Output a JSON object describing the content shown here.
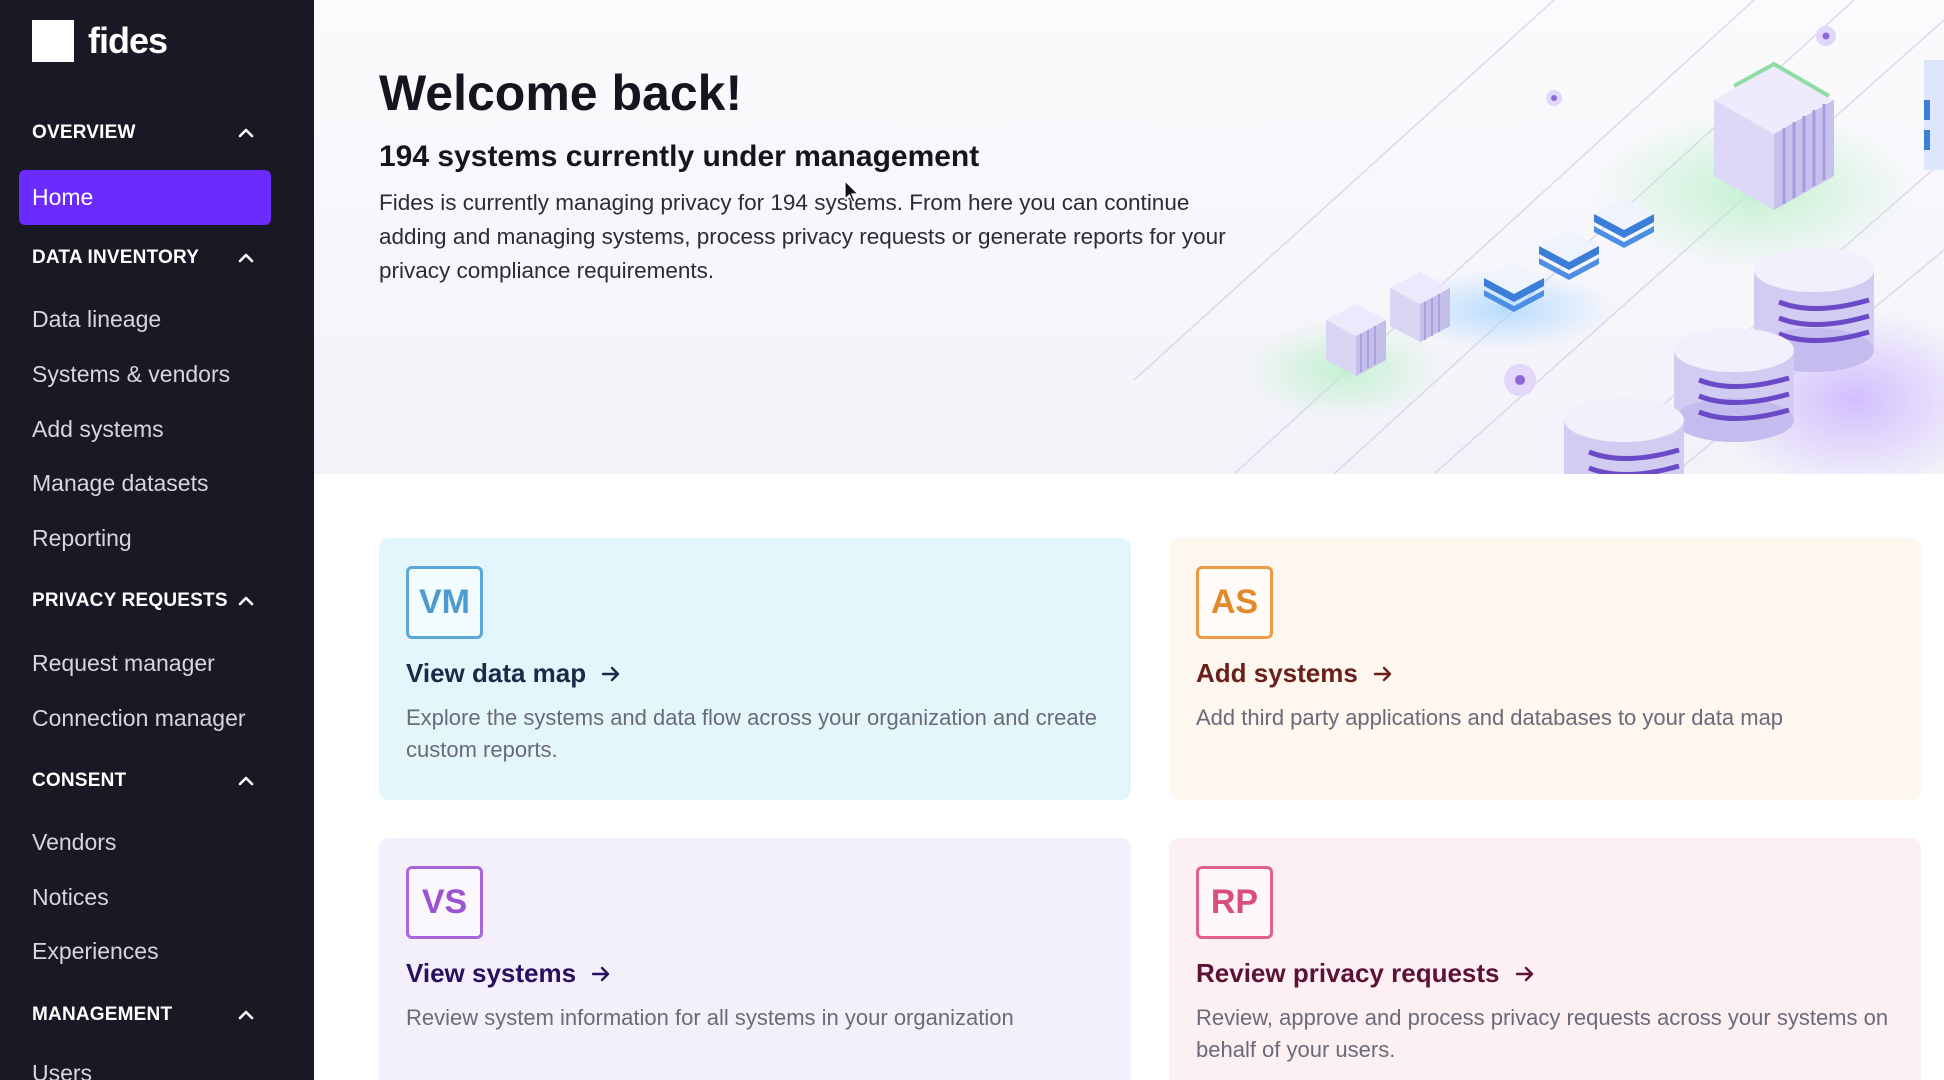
{
  "brand": {
    "name": "fides"
  },
  "sidebar": {
    "sections": [
      {
        "title": "OVERVIEW",
        "items": [
          {
            "label": "Home",
            "active": true
          }
        ]
      },
      {
        "title": "DATA INVENTORY",
        "items": [
          {
            "label": "Data lineage"
          },
          {
            "label": "Systems & vendors"
          },
          {
            "label": "Add systems"
          },
          {
            "label": "Manage datasets"
          },
          {
            "label": "Reporting"
          }
        ]
      },
      {
        "title": "PRIVACY REQUESTS",
        "items": [
          {
            "label": "Request manager"
          },
          {
            "label": "Connection manager"
          }
        ]
      },
      {
        "title": "CONSENT",
        "items": [
          {
            "label": "Vendors"
          },
          {
            "label": "Notices"
          },
          {
            "label": "Experiences"
          }
        ]
      },
      {
        "title": "MANAGEMENT",
        "items": [
          {
            "label": "Users"
          }
        ]
      }
    ]
  },
  "hero": {
    "title": "Welcome back!",
    "subtitle": "194 systems currently under management",
    "description": "Fides is currently managing privacy for 194 systems. From here you can continue adding and managing systems, process privacy requests or generate reports for your privacy compliance requirements."
  },
  "cards": [
    {
      "badge": "VM",
      "title": "View data map",
      "description": "Explore the systems and data flow across your organization and create custom reports."
    },
    {
      "badge": "AS",
      "title": "Add systems",
      "description": "Add third party applications and databases to your data map"
    },
    {
      "badge": "VS",
      "title": "View systems",
      "description": "Review system information for all systems in your organization"
    },
    {
      "badge": "RP",
      "title": "Review privacy requests",
      "description": "Review, approve and process privacy requests across your systems on behalf of your users."
    }
  ],
  "colors": {
    "sidebar_bg": "#191925",
    "active_nav": "#6b2bff",
    "vm": "#4d9ad0",
    "as": "#e2892b",
    "vs": "#9a54d3",
    "rp": "#d84f7e"
  }
}
